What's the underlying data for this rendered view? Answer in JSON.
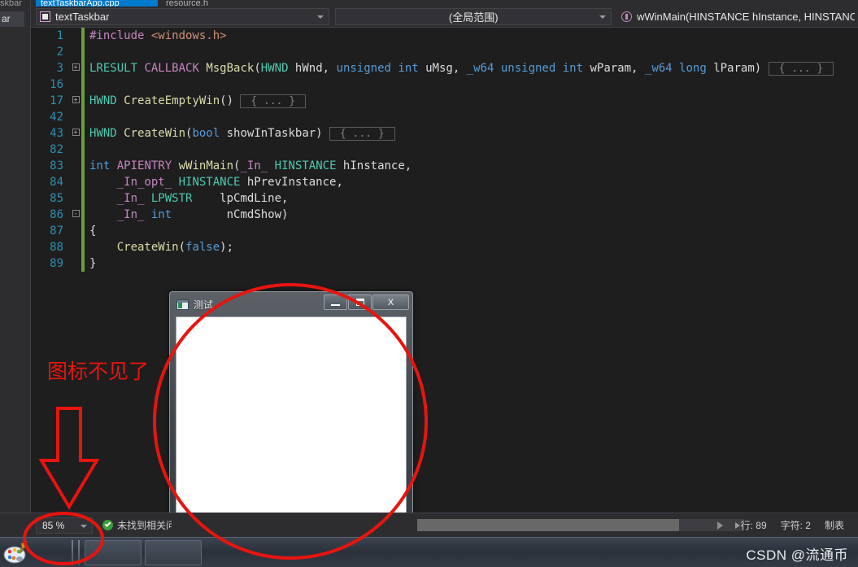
{
  "ide": {
    "left_stub": {
      "label_top": "skbar",
      "label": "ar"
    },
    "tabs": [
      {
        "label": "textTaskbarApp.cpp",
        "active": true,
        "close": "✕",
        "pin": "⚐"
      },
      {
        "label": "resource.h",
        "active": false
      }
    ],
    "navbar": {
      "project_combo": {
        "value": "textTaskbar",
        "icon": "project-icon"
      },
      "scope_combo": {
        "value": "(全局范围)"
      },
      "member_combo": {
        "value": "wWinMain(HINSTANCE hInstance, HINSTANCE h",
        "icon": "method-icon"
      }
    },
    "code_lines": [
      {
        "num": "1",
        "fold": "",
        "changed": true,
        "indent": 0,
        "tokens": [
          {
            "t": "#include ",
            "c": "macro"
          },
          {
            "t": "<windows.h>",
            "c": "str"
          }
        ]
      },
      {
        "num": "2",
        "fold": "",
        "changed": true,
        "indent": 0,
        "tokens": []
      },
      {
        "num": "3",
        "fold": "+",
        "changed": true,
        "indent": 0,
        "tokens": [
          {
            "t": "LRESULT",
            "c": "type"
          },
          {
            "t": " ",
            "c": "plain"
          },
          {
            "t": "CALLBACK",
            "c": "macro"
          },
          {
            "t": " ",
            "c": "plain"
          },
          {
            "t": "MsgBack",
            "c": "fn"
          },
          {
            "t": "(",
            "c": "plain"
          },
          {
            "t": "HWND",
            "c": "type"
          },
          {
            "t": " hWnd, ",
            "c": "plain"
          },
          {
            "t": "unsigned",
            "c": "kw"
          },
          {
            "t": " ",
            "c": "plain"
          },
          {
            "t": "int",
            "c": "kw"
          },
          {
            "t": " uMsg, ",
            "c": "plain"
          },
          {
            "t": "_w64",
            "c": "kw"
          },
          {
            "t": " ",
            "c": "plain"
          },
          {
            "t": "unsigned",
            "c": "kw"
          },
          {
            "t": " ",
            "c": "plain"
          },
          {
            "t": "int",
            "c": "kw"
          },
          {
            "t": " wParam, ",
            "c": "plain"
          },
          {
            "t": "_w64",
            "c": "kw"
          },
          {
            "t": " ",
            "c": "plain"
          },
          {
            "t": "long",
            "c": "kw"
          },
          {
            "t": " lParam)",
            "c": "plain"
          }
        ],
        "collapsed": "{ ... }"
      },
      {
        "num": "16",
        "fold": "",
        "changed": true,
        "indent": 0,
        "tokens": []
      },
      {
        "num": "17",
        "fold": "+",
        "changed": true,
        "indent": 0,
        "tokens": [
          {
            "t": "HWND",
            "c": "type"
          },
          {
            "t": " ",
            "c": "plain"
          },
          {
            "t": "CreateEmptyWin",
            "c": "fn"
          },
          {
            "t": "()",
            "c": "plain"
          }
        ],
        "collapsed": "{ ... }"
      },
      {
        "num": "42",
        "fold": "",
        "changed": true,
        "indent": 0,
        "tokens": []
      },
      {
        "num": "43",
        "fold": "+",
        "changed": true,
        "indent": 0,
        "tokens": [
          {
            "t": "HWND",
            "c": "type"
          },
          {
            "t": " ",
            "c": "plain"
          },
          {
            "t": "CreateWin",
            "c": "fn"
          },
          {
            "t": "(",
            "c": "plain"
          },
          {
            "t": "bool",
            "c": "kw"
          },
          {
            "t": " showInTaskbar)",
            "c": "plain"
          }
        ],
        "collapsed": "{ ... }"
      },
      {
        "num": "82",
        "fold": "",
        "changed": true,
        "indent": 0,
        "tokens": []
      },
      {
        "num": "83",
        "fold": "",
        "changed": true,
        "indent": 0,
        "tokens": [
          {
            "t": "int",
            "c": "kw"
          },
          {
            "t": " ",
            "c": "plain"
          },
          {
            "t": "APIENTRY",
            "c": "macro"
          },
          {
            "t": " ",
            "c": "plain"
          },
          {
            "t": "wWinMain",
            "c": "fn"
          },
          {
            "t": "(",
            "c": "plain"
          },
          {
            "t": "_In_",
            "c": "macro"
          },
          {
            "t": " ",
            "c": "plain"
          },
          {
            "t": "HINSTANCE",
            "c": "type"
          },
          {
            "t": " hInstance,",
            "c": "plain"
          }
        ]
      },
      {
        "num": "84",
        "fold": "",
        "changed": true,
        "indent": 1,
        "tokens": [
          {
            "t": "    ",
            "c": "plain"
          },
          {
            "t": "_In_opt_",
            "c": "macro"
          },
          {
            "t": " ",
            "c": "plain"
          },
          {
            "t": "HINSTANCE",
            "c": "type"
          },
          {
            "t": " hPrevInstance,",
            "c": "plain"
          }
        ]
      },
      {
        "num": "85",
        "fold": "",
        "changed": true,
        "indent": 1,
        "tokens": [
          {
            "t": "    ",
            "c": "plain"
          },
          {
            "t": "_In_",
            "c": "macro"
          },
          {
            "t": " ",
            "c": "plain"
          },
          {
            "t": "LPWSTR",
            "c": "type"
          },
          {
            "t": "    lpCmdLine,",
            "c": "plain"
          }
        ]
      },
      {
        "num": "86",
        "fold": "-",
        "changed": true,
        "indent": 1,
        "tokens": [
          {
            "t": "    ",
            "c": "plain"
          },
          {
            "t": "_In_",
            "c": "macro"
          },
          {
            "t": " ",
            "c": "plain"
          },
          {
            "t": "int",
            "c": "kw"
          },
          {
            "t": "        nCmdShow)",
            "c": "plain"
          }
        ]
      },
      {
        "num": "87",
        "fold": "",
        "changed": true,
        "indent": 0,
        "tokens": [
          {
            "t": "{",
            "c": "plain"
          }
        ]
      },
      {
        "num": "88",
        "fold": "",
        "changed": true,
        "indent": 1,
        "tokens": [
          {
            "t": "    ",
            "c": "plain"
          },
          {
            "t": "CreateWin",
            "c": "fn"
          },
          {
            "t": "(",
            "c": "plain"
          },
          {
            "t": "false",
            "c": "kw"
          },
          {
            "t": ");",
            "c": "plain"
          }
        ]
      },
      {
        "num": "89",
        "fold": "",
        "changed": true,
        "indent": 0,
        "tokens": [
          {
            "t": "}",
            "c": "plain"
          }
        ]
      }
    ],
    "statusbar": {
      "zoom": "85 %",
      "message": "未找到相关问",
      "line": "行: 89",
      "char": "字符: 2",
      "tab_mode": "制表"
    }
  },
  "popup_window": {
    "title": "测试",
    "minimize_label": "—",
    "maximize_label": "❐",
    "close_label": "X"
  },
  "annotations": {
    "note_text": "图标不见了",
    "color": "#e8140f"
  },
  "taskbar": {
    "watermark": "CSDN @流通币"
  },
  "colors": {
    "accent": "#007acc",
    "editor_bg": "#1e1e1e",
    "chrome_bg": "#2d2d30",
    "annotation_red": "#e8140f",
    "status_ok_green": "#3aa03a"
  }
}
